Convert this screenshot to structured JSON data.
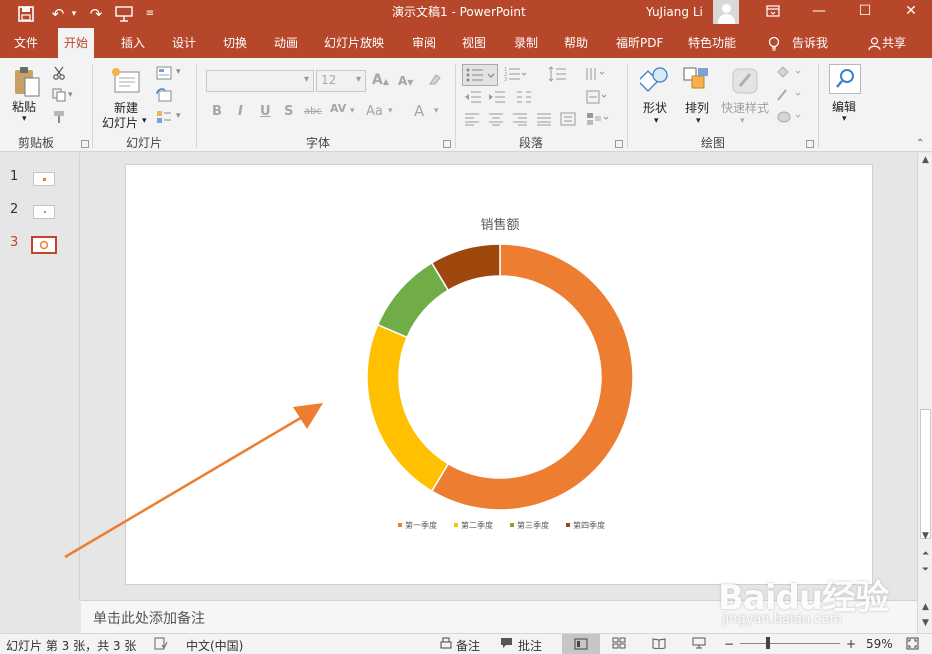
{
  "app": {
    "title": "演示文稿1  -  PowerPoint",
    "user": "YuJiang Li"
  },
  "tabs": [
    {
      "label": "文件",
      "active": false
    },
    {
      "label": "开始",
      "active": true
    },
    {
      "label": "插入",
      "active": false
    },
    {
      "label": "设计",
      "active": false
    },
    {
      "label": "切换",
      "active": false
    },
    {
      "label": "动画",
      "active": false
    },
    {
      "label": "幻灯片放映",
      "active": false
    },
    {
      "label": "审阅",
      "active": false
    },
    {
      "label": "视图",
      "active": false
    },
    {
      "label": "录制",
      "active": false
    },
    {
      "label": "帮助",
      "active": false
    },
    {
      "label": "福昕PDF",
      "active": false
    },
    {
      "label": "特色功能",
      "active": false
    },
    {
      "label": "告诉我",
      "active": false
    },
    {
      "label": "共享",
      "active": false
    }
  ],
  "ribbon": {
    "paste": "粘贴",
    "new_slide_1": "新建",
    "new_slide_2": "幻灯片",
    "font_size": "12",
    "shape": "形状",
    "arrange": "排列",
    "quick_style": "快速样式",
    "edit": "编辑",
    "groups": {
      "clipboard": "剪贴板",
      "slides": "幻灯片",
      "font": "字体",
      "paragraph": "段落",
      "drawing": "绘图"
    }
  },
  "thumbs": [
    {
      "num": "1",
      "active": false
    },
    {
      "num": "2",
      "active": false
    },
    {
      "num": "3",
      "active": true
    }
  ],
  "chart_data": {
    "type": "pie",
    "subtype": "doughnut",
    "title": "销售额",
    "categories": [
      "第一季度",
      "第二季度",
      "第三季度",
      "第四季度"
    ],
    "values": [
      8.2,
      3.2,
      1.4,
      1.2
    ],
    "colors": [
      "#ed7d31",
      "#ffc000",
      "#70ad47",
      "#9e480e"
    ],
    "legend_position": "bottom"
  },
  "notes": {
    "placeholder": "单击此处添加备注"
  },
  "status": {
    "slide_info": "幻灯片 第 3 张，共 3 张",
    "language": "中文(中国)",
    "notes_btn": "备注",
    "comments_btn": "批注",
    "zoom": "59%"
  },
  "watermark": {
    "brand": "Baidu经验",
    "url": "jingyan.baidu.com"
  }
}
